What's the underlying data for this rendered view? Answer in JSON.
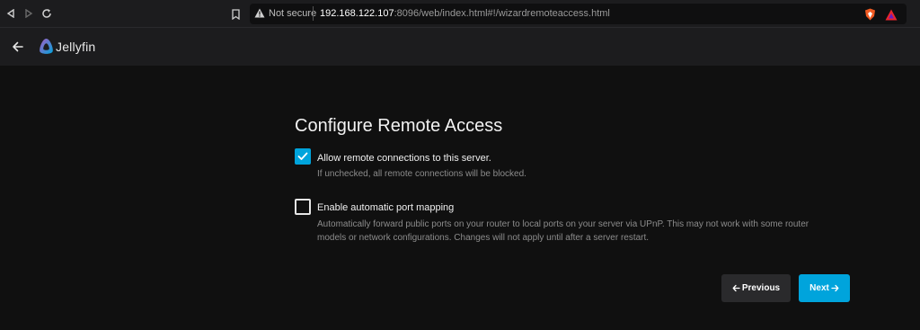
{
  "browser": {
    "security_label": "Not secure",
    "url_host": "192.168.122.107",
    "url_rest": ":8096/web/index.html#!/wizardremoteaccess.html",
    "icons": [
      "back-icon",
      "forward-icon",
      "reload-icon",
      "bookmark-icon",
      "warning-icon",
      "brave-shield-icon",
      "brave-rewards-icon"
    ]
  },
  "header": {
    "app_name": "Jellyfin",
    "icons": [
      "back-arrow-icon",
      "jellyfin-logo-icon"
    ]
  },
  "main": {
    "title": "Configure Remote Access",
    "options": [
      {
        "label": "Allow remote connections to this server.",
        "description": "If unchecked, all remote connections will be blocked.",
        "checked": true
      },
      {
        "label": "Enable automatic port mapping",
        "description_line1": "Automatically forward public ports on your router to local ports on your server via UPnP. This may not work with some router",
        "description_line2": "models or network configurations. Changes will not apply until after a server restart.",
        "checked": false
      }
    ],
    "buttons": {
      "previous_label": "Previous",
      "next_label": "Next"
    }
  },
  "colors": {
    "accent": "#00a4dc",
    "background": "#101010",
    "header": "#1c1c1e"
  }
}
